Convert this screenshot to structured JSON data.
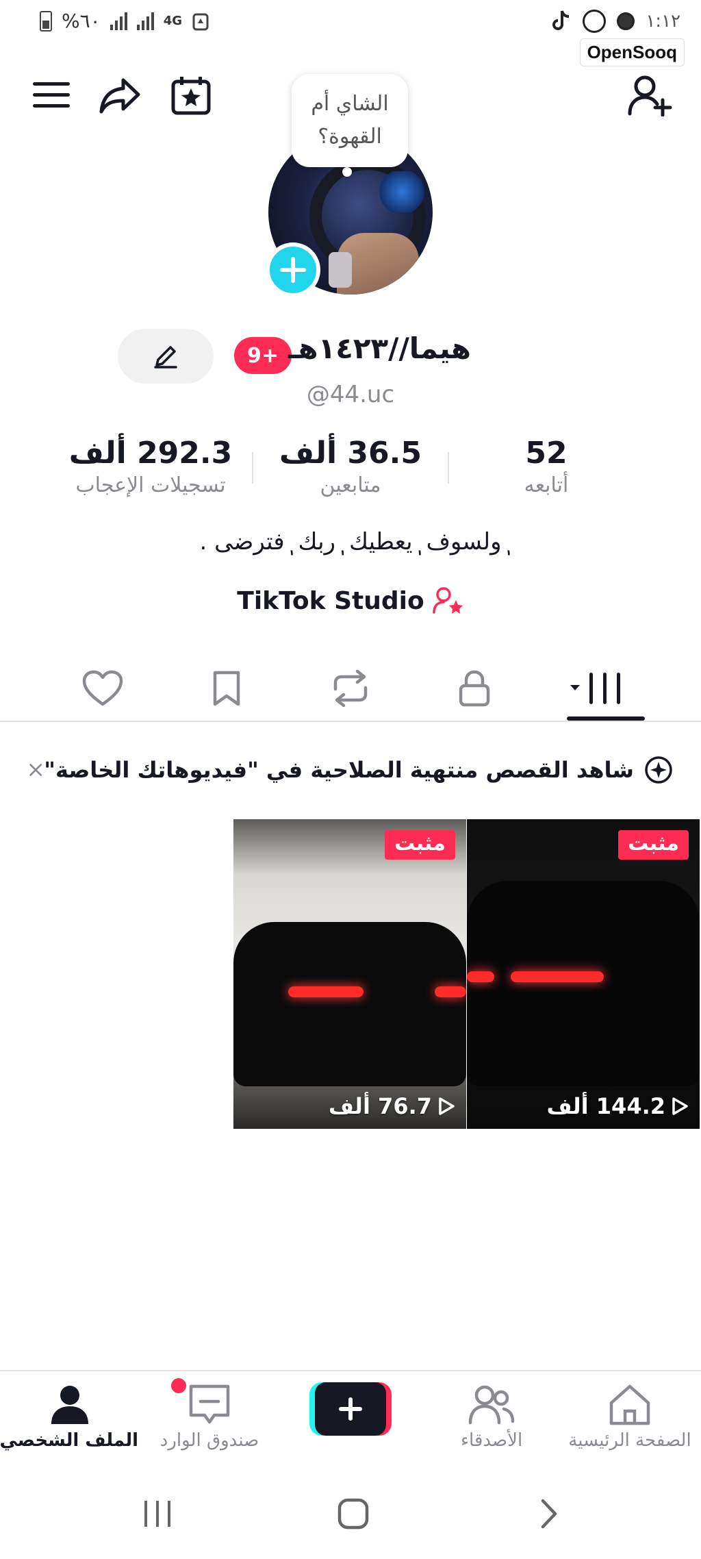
{
  "status_bar": {
    "battery_text": "%٦٠",
    "network": "4G",
    "time": "١:١٢",
    "watermark": "OpenSooq"
  },
  "header": {
    "icons": [
      "menu-icon",
      "share-icon",
      "calendar-star-icon",
      "add-friend-icon"
    ]
  },
  "profile": {
    "speech_bubble": "الشاي أم القهوة؟",
    "name": "هيما//١٤٢٣هـ",
    "name_badge": "9+",
    "username": "@44.uc",
    "bio": "ٖولسوف ٖيعطيك ٖربك ٖفترضى .",
    "studio_label": "TikTok Studio"
  },
  "stats": [
    {
      "value": "52",
      "label": "أتابعه"
    },
    {
      "value": "36.5 ألف",
      "label": "متابعين"
    },
    {
      "value": "292.3 ألف",
      "label": "تسجيلات الإعجاب"
    }
  ],
  "tabs": [
    "videos-grid",
    "private",
    "reposts",
    "favorites",
    "liked"
  ],
  "banner": {
    "text": "شاهد القصص منتهية الصلاحية في \"فيديوهاتك الخاصة\""
  },
  "videos": [
    {
      "badge": "مثبت",
      "views": "144.2 ألف"
    },
    {
      "badge": "مثبت",
      "views": "76.7 ألف"
    }
  ],
  "bottom_nav": {
    "home": "الصفحة الرئيسية",
    "friends": "الأصدقاء",
    "inbox": "صندوق الوارد",
    "profile": "الملف الشخصي"
  },
  "colors": {
    "accent": "#fe2c55",
    "cyan": "#25f4ee",
    "text": "#161823",
    "muted": "#8a8b91"
  }
}
